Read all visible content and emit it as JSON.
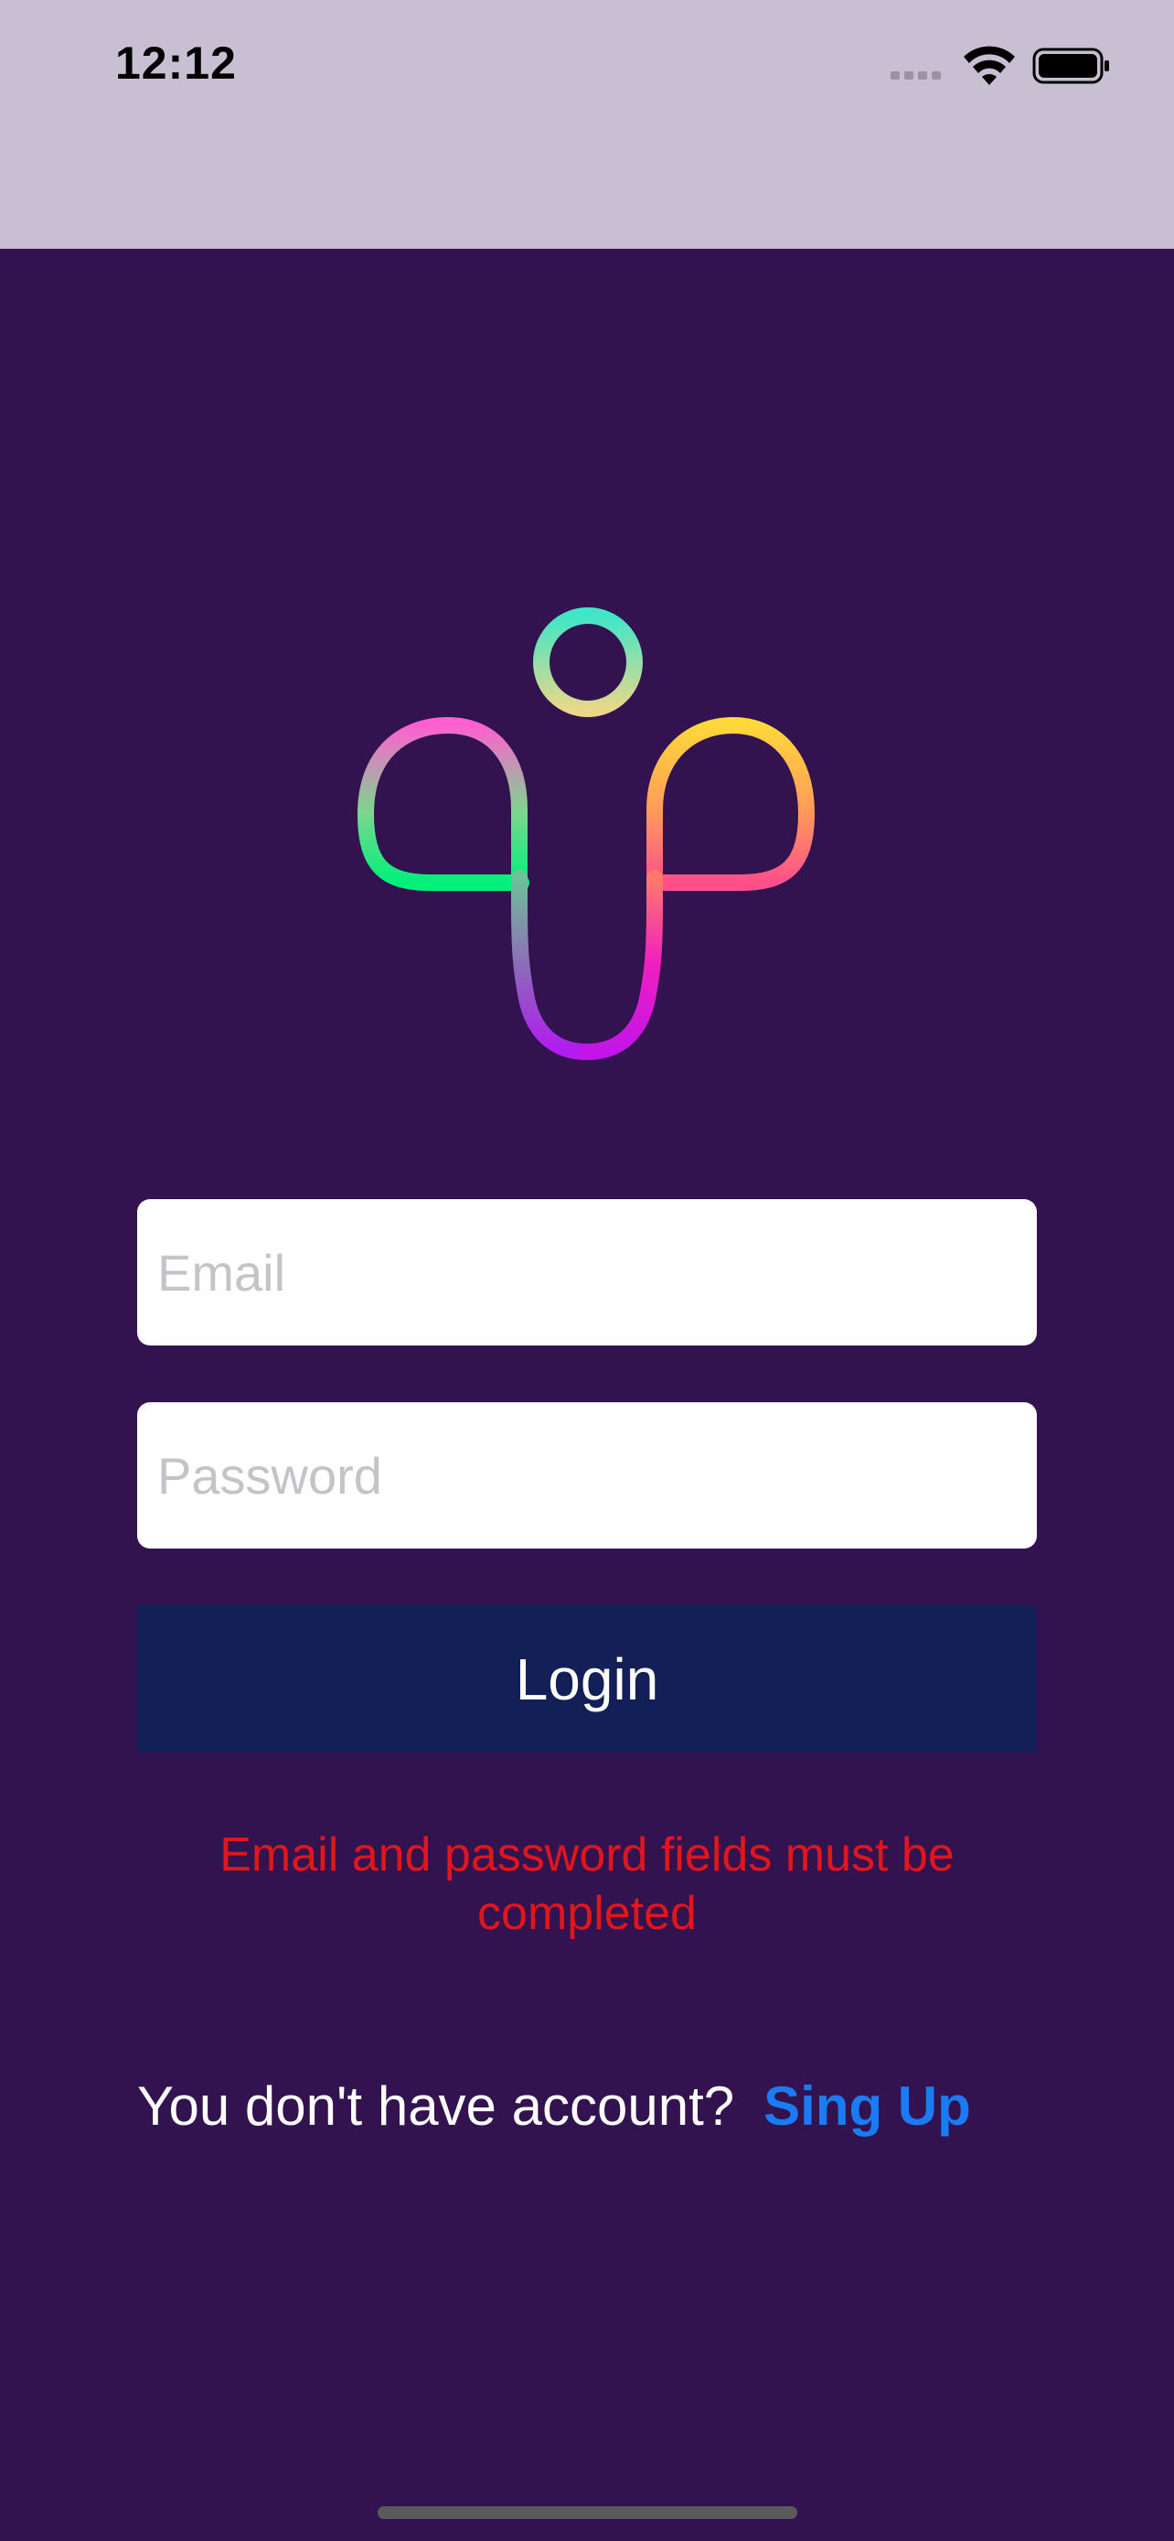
{
  "status_bar": {
    "time": "12:12",
    "icons": [
      "signal-dots-icon",
      "wifi-icon",
      "battery-icon"
    ],
    "background_color": "#c8bfd3"
  },
  "logo": {
    "icon": "rainbow-person-logo-icon"
  },
  "form": {
    "email_placeholder": "Email",
    "email_value": "",
    "password_placeholder": "Password",
    "password_value": "",
    "login_label": "Login",
    "error_message": "Email and password fields must be completed"
  },
  "footer": {
    "prompt": "You don't have account?",
    "signup_label": "Sing Up"
  },
  "colors": {
    "background": "#32134f",
    "button": "#131f57",
    "error": "#e0161c",
    "link": "#1b7bf3"
  }
}
